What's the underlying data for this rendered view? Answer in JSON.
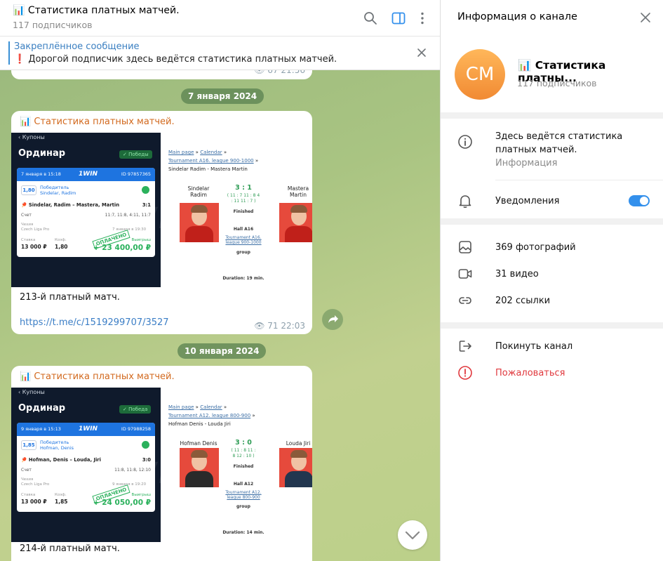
{
  "header": {
    "icon": "📊",
    "title": "Статистика платных матчей.",
    "subscribers": "117 подписчиков"
  },
  "pinned": {
    "label": "Закреплённое сообщение",
    "icon": "❗",
    "text": "Дорогой подписчик здесь ведётся статистика платных  матчей."
  },
  "partial_meta": {
    "views": "67",
    "time": "21:56"
  },
  "messages": [
    {
      "date": "7 января 2024",
      "sender_icon": "📊",
      "sender": "Статистика платных матчей.",
      "coupon": {
        "back": "Купоны",
        "title": "Ординар",
        "badge": "Победы",
        "date": "7 января в 15:18",
        "brand": "1WIN",
        "id": "ID 97857365",
        "coef": "1,80",
        "bet_type": "Победитель",
        "player": "Sindelar, Radim",
        "match": "Sindelar, Radim – Mastera, Martin",
        "result": "3:1",
        "score_label": "Счет",
        "score": "11:7, 11:8, 4:11, 11:7",
        "country": "Чехия",
        "league": "Czech Liga Pro",
        "when": "7 января в 19:30",
        "stake_label": "Ставка",
        "coef_label": "Коэф.",
        "stake": "13 000 ₽",
        "coef2": "1,80",
        "win_label": "Выигрыш",
        "win": "+ 23 400,00 ₽",
        "stamp": "ОПЛАЧЕНО"
      },
      "result": {
        "bc1": "Main page",
        "sep": "»",
        "bc2": "Calendar",
        "bc3": "Tournament A16. league 900-1000",
        "players": "Sindelar Radim - Mastera Martin",
        "p1": "Sindelar Radim",
        "p2": "Mastera Martin",
        "p1a": "Sindelar",
        "p1b": "Radim",
        "p2a": "Mastera",
        "p2b": "Martin",
        "score": "3 : 1",
        "sets1": "( 11 : 7   11 : 8   4",
        "sets2": ": 11   11 : 7 )",
        "finished": "Finished",
        "hall": "Hall A16",
        "tourn1": "Tournament A16.",
        "tourn2": "league 900-1000",
        "group": "group",
        "duration": "Duration: 19 min."
      },
      "text": "213-й платный матч.",
      "link": "https://t.me/c/1519299707/3527",
      "views": "71",
      "time": "22:03"
    },
    {
      "date": "10 января 2024",
      "sender_icon": "📊",
      "sender": "Статистика платных матчей.",
      "coupon": {
        "back": "Купоны",
        "title": "Ординар",
        "badge": "Победа",
        "date": "9 января в 15:13",
        "brand": "1WIN",
        "id": "ID 97988258",
        "coef": "1,85",
        "bet_type": "Победитель",
        "player": "Hofman, Denis",
        "match": "Hofman, Denis – Louda, Jiri",
        "result": "3:0",
        "score_label": "Счет",
        "score": "11:8, 11:8, 12:10",
        "country": "Чехия",
        "league": "Czech Liga Pro",
        "when": "9 января в 19:20",
        "stake_label": "Ставка",
        "coef_label": "Коэф.",
        "stake": "13 000 ₽",
        "coef2": "1,85",
        "win_label": "Выигрыш",
        "win": "+ 24 050,00 ₽",
        "stamp": "ОПЛАЧЕНО"
      },
      "result": {
        "bc1": "Main page",
        "sep": "»",
        "bc2": "Calendar",
        "bc3": "Tournament A12. league 800-900",
        "players": "Hofman Denis - Louda Jiri",
        "p1": "Hofman Denis",
        "p2": "Louda Jiri",
        "score": "3 : 0",
        "sets1": "( 11 : 8   11 :",
        "sets2": "8   12 : 10 )",
        "finished": "Finished",
        "hall": "Hall A12",
        "tourn1": "Tournament A12.",
        "tourn2": "league 800-900",
        "group": "group",
        "duration": "Duration: 14 min."
      },
      "text": "214-й платный матч."
    }
  ],
  "info": {
    "title": "Информация о канале",
    "avatar": "CM",
    "name": "Статистика платны...",
    "name_icon": "📊",
    "subscribers": "117 подписчиков",
    "description1": "Здесь ведётся статистика",
    "description2": "платных матчей.",
    "description_label": "Информация",
    "notifications": "Уведомления",
    "photos": "369 фотографий",
    "videos": "31 видео",
    "links": "202 ссылки",
    "leave": "Покинуть канал",
    "report": "Пожаловаться",
    "report_color": "#e0393e"
  }
}
